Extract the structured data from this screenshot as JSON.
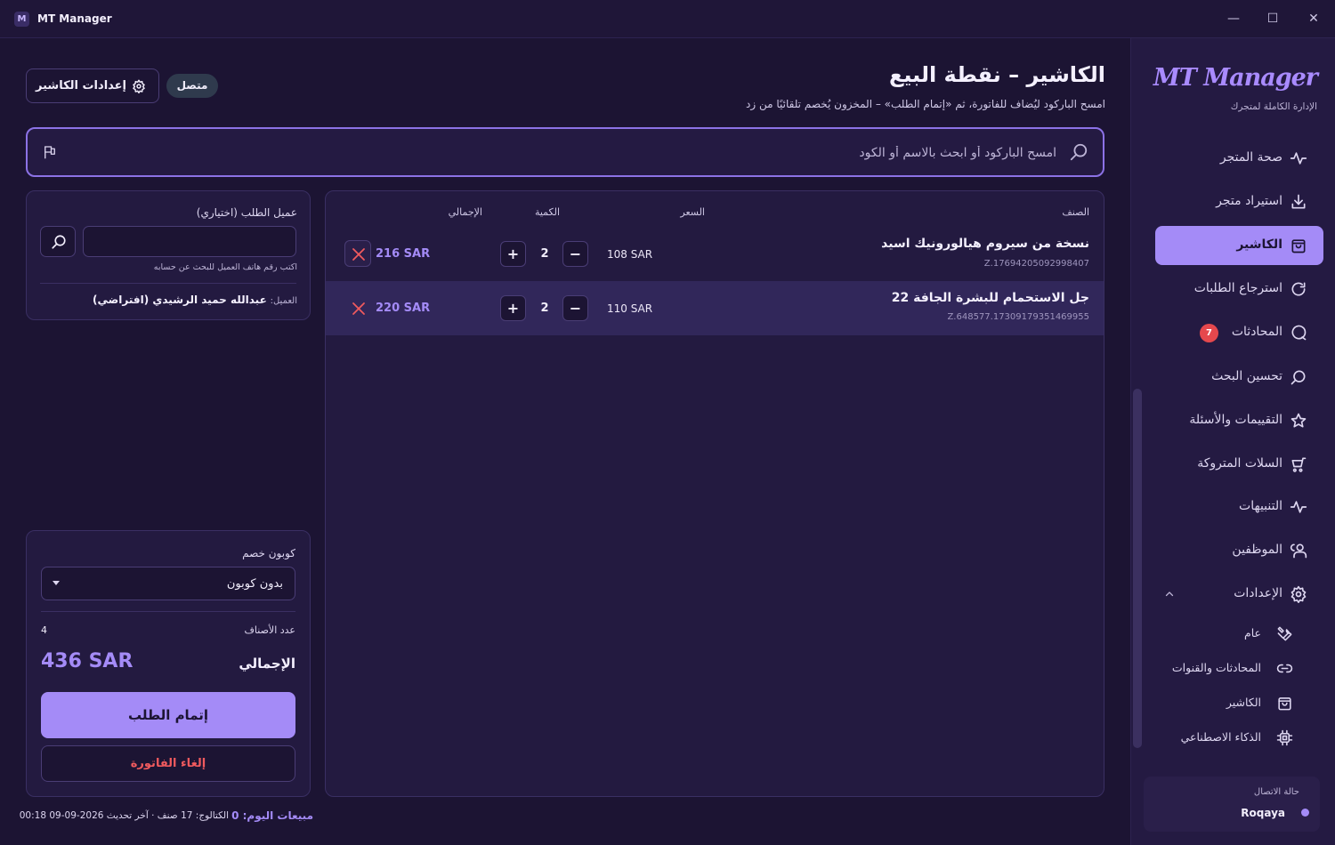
{
  "window": {
    "title": "MT Manager",
    "logo_letter": "M",
    "minimize": "—",
    "maximize": "☐",
    "close": "✕"
  },
  "sidebar": {
    "brand": "MT Manager",
    "brand_sub": "الإدارة الكاملة لمتجرك",
    "items": [
      {
        "label": "صحة المتجر",
        "icon": "pulse-icon"
      },
      {
        "label": "استيراد متجر",
        "icon": "download-icon"
      },
      {
        "label": "الكاشير",
        "icon": "shopping-bag-icon",
        "active": true
      },
      {
        "label": "استرجاع الطلبات",
        "icon": "refresh-icon"
      },
      {
        "label": "المحادثات",
        "icon": "chat-icon",
        "badge": "7"
      },
      {
        "label": "تحسين البحث",
        "icon": "search-icon"
      },
      {
        "label": "التقييمات والأسئلة",
        "icon": "star-icon"
      },
      {
        "label": "السلات المتروكة",
        "icon": "cart-icon"
      },
      {
        "label": "التنبيهات",
        "icon": "pulse-icon"
      },
      {
        "label": "الموظفين",
        "icon": "users-icon"
      },
      {
        "label": "الإعدادات",
        "icon": "gear-icon",
        "expanded": true
      }
    ],
    "sub_items": [
      {
        "label": "عام",
        "icon": "wrench-icon"
      },
      {
        "label": "المحادثات والقنوات",
        "icon": "link-icon"
      },
      {
        "label": "الكاشير",
        "icon": "shopping-bag-icon"
      },
      {
        "label": "الذكاء الاصطناعي",
        "icon": "chip-icon"
      }
    ],
    "connection": {
      "label": "حالة الاتصال",
      "user": "Roqaya",
      "status_color": "#a48bf7"
    }
  },
  "header": {
    "title": "الكاشير – نقطة البيع",
    "subtitle": "امسح الباركود ليُضاف للفاتورة، ثم «إتمام الطلب» – المخزون يُخصم تلقائيًا من زد",
    "settings_label": "إعدادات الكاشير",
    "status": "متصل"
  },
  "search": {
    "placeholder": "امسح الباركود أو ابحث بالاسم أو الكود"
  },
  "cart": {
    "columns": {
      "item": "الصنف",
      "price": "السعر",
      "qty": "الكمية",
      "total": "الإجمالي"
    },
    "rows": [
      {
        "name": "نسخة من سيروم هيالورونيك اسيد",
        "code": "Z.17694205092998407",
        "price": "108 SAR",
        "qty": "2",
        "total": "216 SAR",
        "minus": "−",
        "plus": "+"
      },
      {
        "name": "جل الاستحمام للبشرة الجافة 22",
        "code": "Z.648577.17309179351469955",
        "price": "110 SAR",
        "qty": "2",
        "total": "220 SAR",
        "minus": "−",
        "plus": "+"
      }
    ]
  },
  "customer": {
    "label": "عميل الطلب (اختياري)",
    "input_value": "",
    "hint": "اكتب رقم هاتف العميل للبحث عن حسابه",
    "current_key": "العميل:",
    "current_value": "عبدالله حميد الرشيدي (افتراضي)"
  },
  "summary": {
    "coupon_label": "كوبون خصم",
    "coupon_value": "بدون كوبون",
    "count_label": "عدد الأصناف",
    "count_value": "4",
    "total_label": "الإجمالي",
    "total_value": "436 SAR",
    "checkout_label": "إتمام الطلب",
    "cancel_label": "إلغاء الفاتورة"
  },
  "footer": {
    "sales": "مبيعات اليوم: 0",
    "catalog": "الكتالوج: 17 صنف · آخر تحديث 2026-09-09 00:18"
  },
  "colors": {
    "accent": "#a48bf7",
    "danger": "#f05a5e",
    "badge": "#e5484d",
    "background": "#1c1433"
  }
}
